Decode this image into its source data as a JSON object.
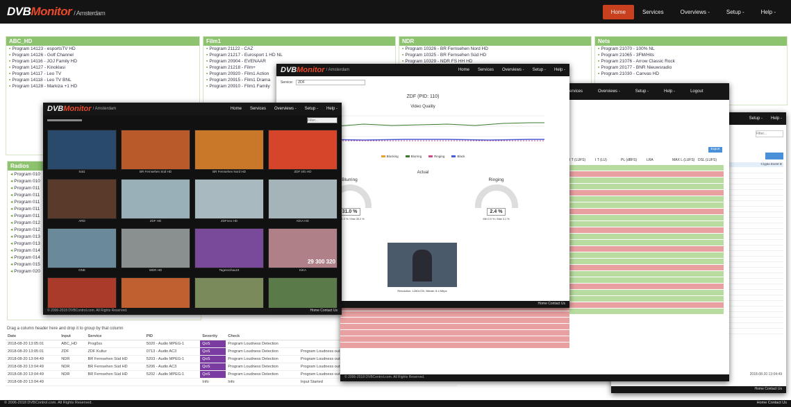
{
  "nav": {
    "brand_a": "DVB",
    "brand_b": "Monitor",
    "location": "/ Amsterdam",
    "links": [
      "Home",
      "Services",
      "Overviews -",
      "Setup -",
      "Help -"
    ]
  },
  "groups": [
    {
      "title": "ABC_HD",
      "items": [
        "Program 14123 - esportsTV HD",
        "Program 14126 - Golf Channel",
        "Program 14116 - JOJ Family HD",
        "Program 14127 - Kinoklasi",
        "Program 14117 - Leo TV",
        "Program 14118 - Leo TV BNL",
        "Program 14128 - Markiza +1 HD"
      ]
    },
    {
      "title": "Film1",
      "items": [
        "Program 21122 - CAZ",
        "Program 21217 - Eurosport 1 HD NL",
        "Program 20904 - EVENAAR",
        "Program 21218 - Film+",
        "Program 20920 - Film1 Action",
        "Program 20915 - Film1 Drama",
        "Program 20910 - Film1 Family"
      ]
    },
    {
      "title": "NDR",
      "items": [
        "Program 10326 - BR Fernsehen Nord HD",
        "Program 10325 - BR Fernsehen Süd HD",
        "Program 10329 - NDR FS HH HD"
      ]
    },
    {
      "title": "Nets",
      "items": [
        "Program 21070 - 100% NL",
        "Program 21065 - 3FM/Hits",
        "Program 21076 - Arrow Classic Rock",
        "Program 20177 - BNR Nieuwsradio",
        "Program 21030 - Canvas HD"
      ]
    }
  ],
  "radios": {
    "title": "Radios",
    "items": [
      "Program 010",
      "Program 010",
      "Program 011",
      "Program 011",
      "Program 011",
      "Program 011",
      "Program 011",
      "Program 012",
      "Program 012",
      "Program 013",
      "Program 013",
      "Program 014",
      "Program 014",
      "Program 015",
      "Program 020"
    ]
  },
  "events": {
    "hint": "Drag a column header here and drop it to group by that column",
    "headers": [
      "Date",
      "Input",
      "Service",
      "PID",
      "Severity",
      "Check",
      ""
    ],
    "rows": [
      [
        "2018-08-20 13:05:01",
        "ABC_HD",
        "Prog0ss",
        "5020 - Audio MPEG-1",
        "QoS",
        "Program Loudness Detection",
        ""
      ],
      [
        "2018-08-20 13:05:01",
        "ZDF",
        "ZDF Kultur",
        "0713 - Audio AC3",
        "QoS",
        "Program Loudness Detection",
        "Program Loudness out of range: [50] Nachrichten -- -7.5 LU"
      ],
      [
        "2018-08-20 13:04:49",
        "NDR",
        "BR Fernsehen Süd HD",
        "5203 - Audio MPEG-1",
        "QoS",
        "Program Loudness Detection",
        "Program Loudness out of range: [225] Dings vom Dach -- -5.1 LU"
      ],
      [
        "2018-08-20 13:04:49",
        "NDR",
        "BR Fernsehen Süd HD",
        "5206 - Audio AC3",
        "QoS",
        "Program Loudness Detection",
        "Program Loudness out of range: [225] Dings vom Dach -- -39.8 LU"
      ],
      [
        "2018-08-20 13:04:49",
        "NDR",
        "BR Fernsehen Süd HD",
        "5202 - Audio MPEG-1",
        "QoS",
        "Program Loudness Detection",
        "Program Loudness out of range: [225] Dings vom Dach -- -5.1 LU"
      ],
      [
        "2018-08-20 13:04:49",
        "",
        "",
        "",
        "Info",
        "Info",
        "Input Started"
      ]
    ]
  },
  "footer": {
    "copyright": "© 2006-2018 DVBControl.com. All Rights Reserved.",
    "links": "Home   Contact Us"
  },
  "win_mosaic": {
    "brand_a": "DVB",
    "brand_b": "Monitor",
    "loc": "/ Amsterdam",
    "links": [
      "Home",
      "Services",
      "Overviews -",
      "Setup -",
      "Help -"
    ],
    "filter_placeholder": "Filter...",
    "foot": "© 2006-2018 DVBControl.com. All Rights Reserved.",
    "foot_links": "Home   Contact Us",
    "thumbs": [
      {
        "label": "Sat1",
        "color": "#2a4a6b"
      },
      {
        "label": "BR Fernsehen Süd HD",
        "color": "#b85a2a"
      },
      {
        "label": "BR Fernsehen Nord HD",
        "color": "#c9782a"
      },
      {
        "label": "ZDF info HD",
        "color": "#d6452a"
      },
      {
        "label": "ARD",
        "color": "#5a3a2a"
      },
      {
        "label": "ZDF HD",
        "color": "#9ab0b8"
      },
      {
        "label": "ZDFneo HD",
        "color": "#a8bac0"
      },
      {
        "label": "KiKA HD",
        "color": "#a4b4b8"
      },
      {
        "label": "ONE",
        "color": "#6a8a9a"
      },
      {
        "label": "WDR HD",
        "color": "#8a9090"
      },
      {
        "label": "Tagesschau24",
        "color": "#7a4a9a"
      },
      {
        "label": "KiKA",
        "color": "#b08088"
      },
      {
        "label": "MDR",
        "color": "#aa3a2a"
      },
      {
        "label": "SR Fernsehen",
        "color": "#c06030"
      },
      {
        "label": "HR",
        "color": "#7a8a5a"
      },
      {
        "label": "SWR",
        "color": "#5a7a4a"
      }
    ],
    "big_number": "29 300 320"
  },
  "win_vq": {
    "brand_a": "DVB",
    "brand_b": "Monitor",
    "loc": "/ Amsterdam",
    "links": [
      "Home",
      "Services",
      "Overviews -",
      "Setup -",
      "Help -"
    ],
    "service_label": "Service:",
    "service_value": "ZDF",
    "title": "ZDF (PID: 110)",
    "subtitle": "Video Quality",
    "legend": [
      "Blocking",
      "Blurring",
      "Ringing",
      "Black"
    ],
    "actual": "Actual",
    "blurring_label": "Blurring",
    "blurring_value": "31.0 %",
    "ringing_label": "Ringing",
    "ringing_value": "2.4 %",
    "blur_minmax": "Min 31.0 % / Max 35.2 %",
    "ring_minmax": "Min 0.0 % / Max 3.1 %",
    "video_caption": "Resolution: 1280x720, Bitrate: 8.4 Mbps",
    "foot_links": "Home   Contact Us"
  },
  "win_loud": {
    "links": [
      "Services",
      "Overviews -",
      "Setup -",
      "Help -",
      "Logout"
    ],
    "headers": [
      "I T (LUFS)",
      "I T (LU)",
      "PL (dBFS)",
      "LRA",
      "MAX L (LUFS)",
      "DSL (LUFS)"
    ],
    "export": "Export",
    "foot": "© 2006-2018 DVBControl.com. All Rights Reserved."
  },
  "win_right": {
    "links": [
      "Setup -",
      "Help -"
    ],
    "filter": "Filter...",
    "col": "Crypto Event D",
    "date_a": "2018-08-20 13:04:49",
    "foot_links": "Home   Contact Us"
  }
}
